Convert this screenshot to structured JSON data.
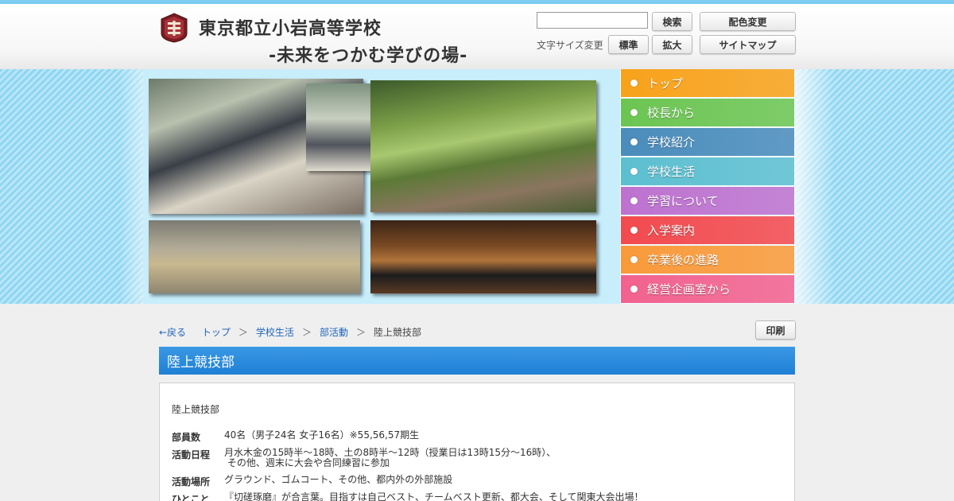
{
  "header": {
    "title_line1": "東京都立小岩高等学校",
    "title_line2": "-未来をつかむ学びの場-",
    "search": {
      "value": "",
      "button": "検索"
    },
    "color_change": "配色変更",
    "font_size_label": "文字サイズ変更",
    "font_standard": "標準",
    "font_large": "拡大",
    "sitemap": "サイトマップ"
  },
  "nav": {
    "items": [
      {
        "label": "トップ",
        "color": "#f8a21b"
      },
      {
        "label": "校長から",
        "color": "#6cc552"
      },
      {
        "label": "学校紹介",
        "color": "#4a8cbc"
      },
      {
        "label": "学校生活",
        "color": "#5cbfd0"
      },
      {
        "label": "学習について",
        "color": "#bd72cf"
      },
      {
        "label": "入学案内",
        "color": "#f24a4f"
      },
      {
        "label": "卒業後の進路",
        "color": "#f99a3a"
      },
      {
        "label": "経営企画室から",
        "color": "#f2628f"
      }
    ]
  },
  "breadcrumb": {
    "back": "←戻る",
    "items": [
      "トップ",
      "学校生活",
      "部活動"
    ],
    "separator": "＞",
    "current": "陸上競技部"
  },
  "print_button": "印刷",
  "page_title": "陸上競技部",
  "content": {
    "title": "陸上競技部",
    "rows": [
      {
        "key": "部員数",
        "value": "40名（男子24名 女子16名）※55,56,57期生"
      },
      {
        "key": "活動日程",
        "value": "月水木金の15時半～18時、土の8時半～12時（授業日は13時15分～16時）、",
        "value2": " その他、週末に大会や合同練習に参加"
      },
      {
        "key": "活動場所",
        "value": "グラウンド、ゴムコート、その他、都内外の外部施設"
      },
      {
        "key": "ひとこと",
        "value": "『切磋琢磨』が合言葉。目指すは自己ベスト、チームベスト更新、都大会、そして関東大会出場！"
      }
    ]
  },
  "colors": {
    "accent_blue": "#2a8ddb",
    "link": "#2266bb",
    "top_bar": "#7ccdf0"
  }
}
